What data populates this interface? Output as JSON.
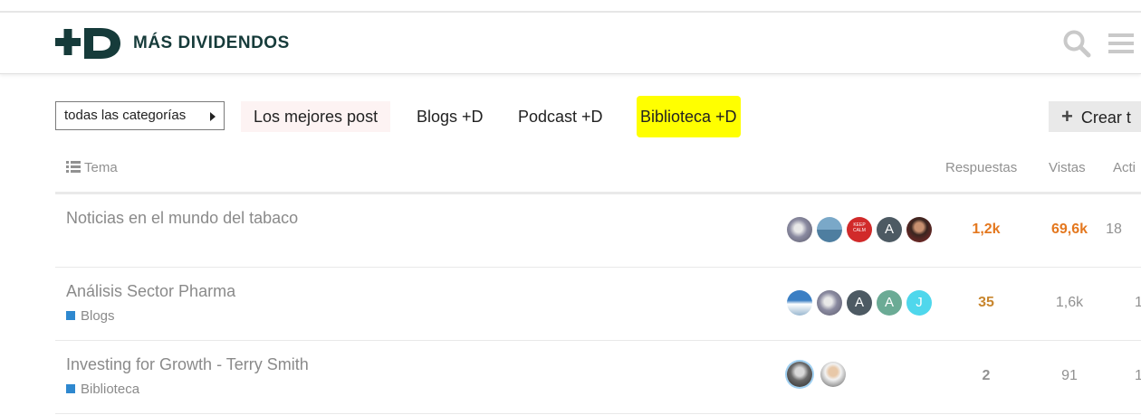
{
  "header": {
    "logo_mark": "+D",
    "logo_text": "MÁS DIVIDENDOS"
  },
  "nav": {
    "category_dropdown": "todas las categorías",
    "items": [
      "Los mejores post",
      "Blogs +D",
      "Podcast +D",
      "Biblioteca +D"
    ],
    "create_button": "Crear t"
  },
  "table": {
    "columns": {
      "topic": "Tema",
      "replies": "Respuestas",
      "views": "Vistas",
      "activity": "Acti"
    },
    "rows": [
      {
        "title": "Noticias en el mundo del tabaco",
        "category": "",
        "posters": [
          "",
          "",
          "KEEP CALM",
          "A",
          ""
        ],
        "replies": "1,2k",
        "views": "69,6k",
        "activity": "18"
      },
      {
        "title": "Análisis Sector Pharma",
        "category": "Blogs",
        "posters": [
          "",
          "",
          "A",
          "A",
          "J"
        ],
        "replies": "35",
        "views": "1,6k",
        "activity": "1"
      },
      {
        "title": "Investing for Growth - Terry Smith",
        "category": "Biblioteca",
        "posters": [
          "",
          ""
        ],
        "replies": "2",
        "views": "91",
        "activity": "1"
      }
    ]
  },
  "colors": {
    "brand": "#163b3a",
    "highlight": "#ffff00",
    "hot_number": "#e4781f",
    "warm_number": "#c8862e",
    "category_blogs": "#2e88cf"
  },
  "icons": [
    "search-icon",
    "menu-icon",
    "list-icon",
    "plus-icon",
    "caret-right-icon"
  ]
}
